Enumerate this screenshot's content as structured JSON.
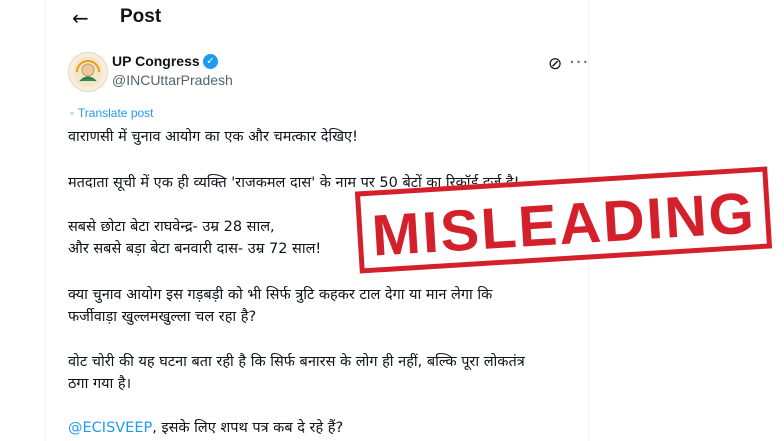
{
  "header": {
    "back_icon": "arrow-left-icon",
    "title": "Post"
  },
  "author": {
    "name": "UP Congress",
    "handle": "@INCUttarPradesh",
    "verified_icon": "verified-badge-icon",
    "verified_color": "#1d9bf0"
  },
  "actions": {
    "grok_icon": "grok-icon",
    "more_icon": "more-icon"
  },
  "translate": {
    "label": "Translate post",
    "icon": "translate-icon"
  },
  "post": {
    "line1": "वाराणसी में चुनाव आयोग का एक और चमत्कार देखिए!",
    "line2": "मतदाता सूची में एक ही व्यक्ति 'राजकमल दास' के नाम पर 50 बेटों का रिकॉर्ड दर्ज है!",
    "line3": "सबसे छोटा बेटा राघवेन्द्र- उम्र 28 साल,",
    "line4": "और सबसे बड़ा बेटा बनवारी दास- उम्र 72 साल!",
    "line5": "क्या चुनाव आयोग इस गड़बड़ी को भी सिर्फ त्रुटि कहकर टाल देगा या मान लेगा कि",
    "line6": "फर्जीवाड़ा खुल्लमखुल्ला चल रहा है?",
    "line7": "वोट चोरी की यह घटना बता रही है कि सिर्फ बनारस के लोग ही नहीं, बल्कि पूरा लोकतंत्र",
    "line8": "ठगा गया है।",
    "mention": "@ECISVEEP",
    "line9_rest": ", इसके लिए शपथ पत्र कब दे रहे हैं?"
  },
  "stamp": {
    "text": "MISLEADING",
    "color": "#d4202a"
  }
}
